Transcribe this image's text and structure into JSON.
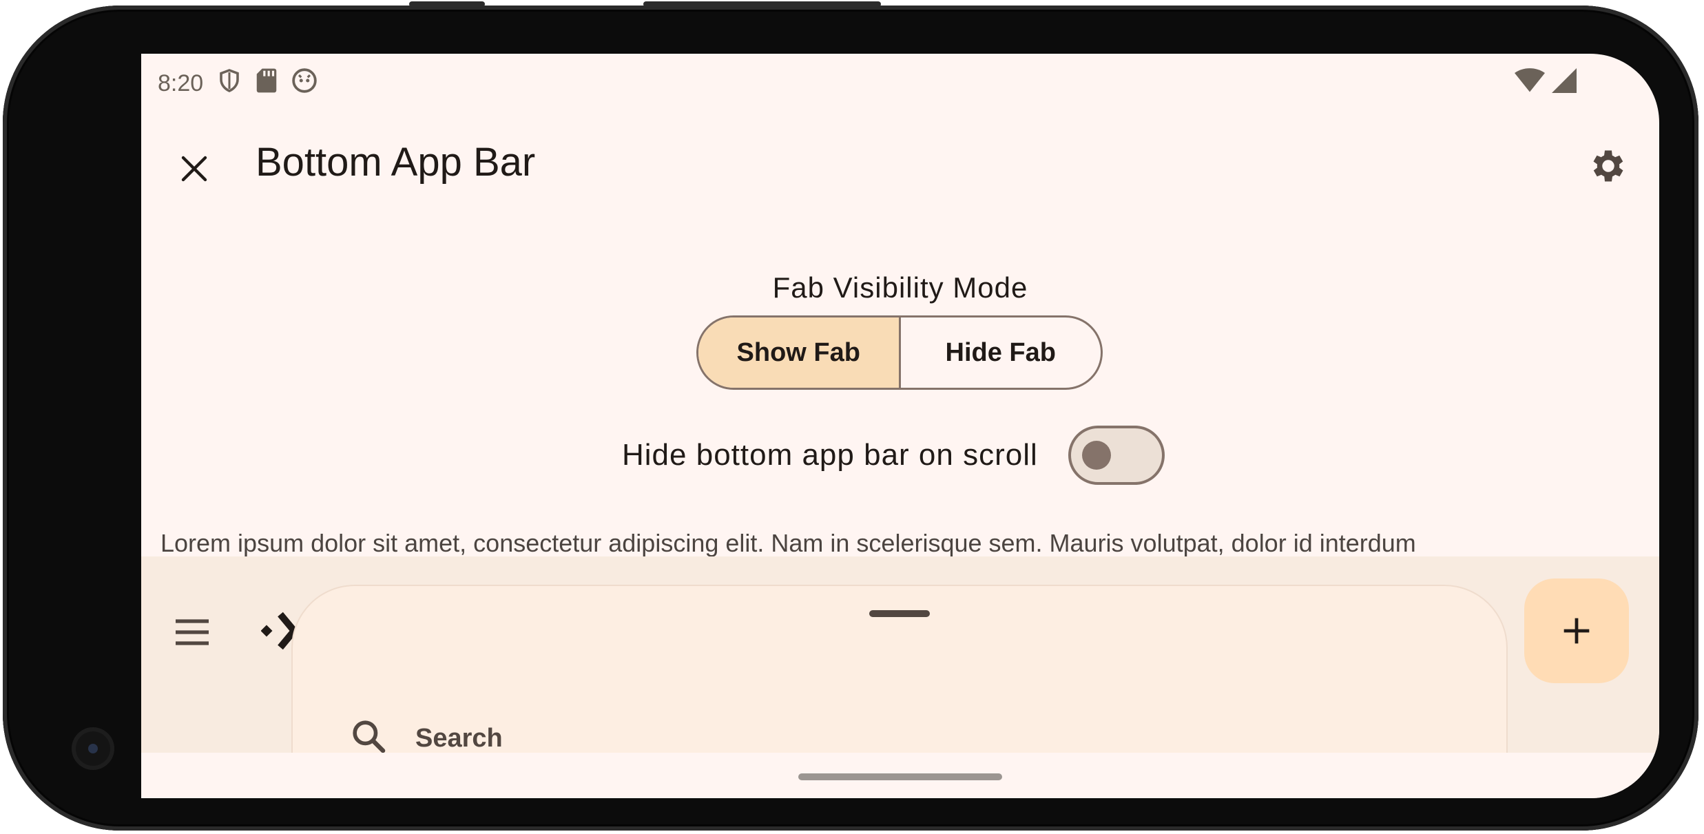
{
  "status_bar": {
    "time": "8:20",
    "left_icons": [
      "shield-icon",
      "sd-card-icon",
      "android-debug-icon"
    ],
    "right_icons": [
      "wifi-icon",
      "signal-icon"
    ]
  },
  "top_app_bar": {
    "title": "Bottom App Bar",
    "left_icon": "close-icon",
    "right_icon": "gear-icon"
  },
  "content": {
    "fab_visibility_label": "Fab Visibility Mode",
    "segments": [
      {
        "label": "Show Fab",
        "selected": true
      },
      {
        "label": "Hide Fab",
        "selected": false
      }
    ],
    "switch_label": "Hide bottom app bar on scroll",
    "switch_on": false,
    "lorem": "Lorem ipsum dolor sit amet, consectetur adipiscing elit. Nam in scelerisque sem. Mauris volutpat, dolor id interdum"
  },
  "bottom_app_bar": {
    "menu_icon": "menu-icon",
    "nav_icon": "navigate-icon",
    "fab_icon": "plus-icon"
  },
  "bottom_sheet": {
    "search_label": "Search"
  },
  "colors": {
    "surface": "#fff5f2",
    "bottom_bar": "#f8ebe0",
    "segment_selected": "#f9dcb6",
    "fab": "#ffdcb5",
    "outline": "#85736a"
  }
}
